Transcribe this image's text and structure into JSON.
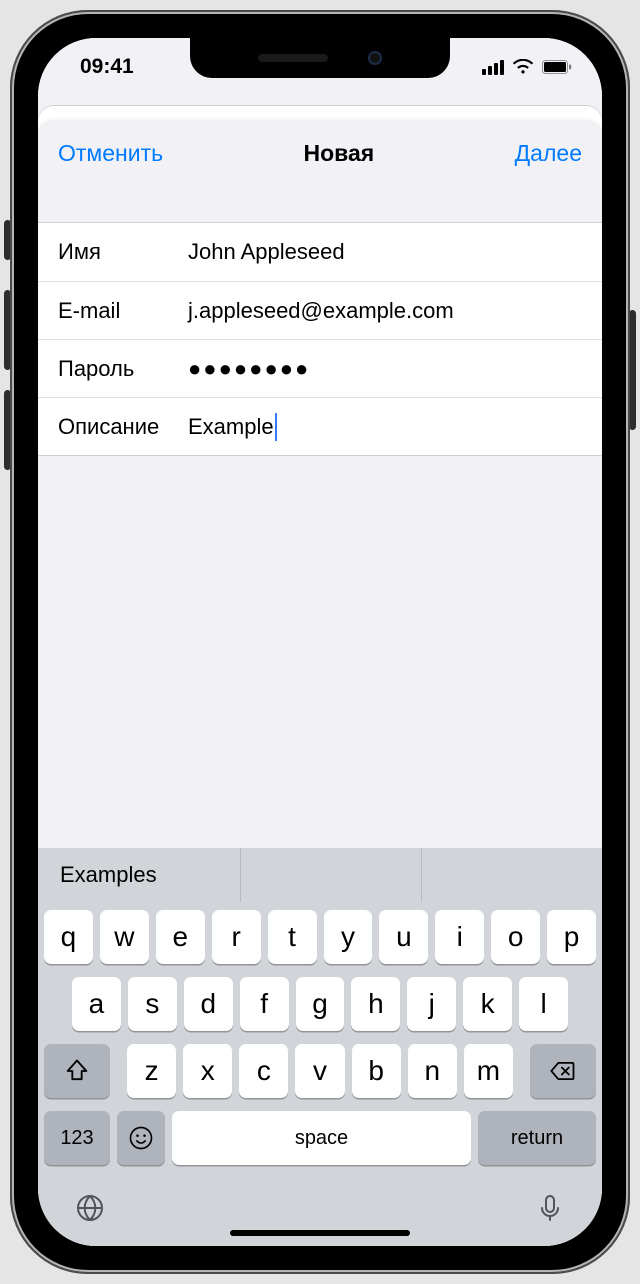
{
  "status": {
    "time": "09:41"
  },
  "nav": {
    "cancel": "Отменить",
    "title": "Новая",
    "next": "Далее"
  },
  "form": {
    "name_label": "Имя",
    "name_value": "John Appleseed",
    "email_label": "E-mail",
    "email_value": "j.appleseed@example.com",
    "password_label": "Пароль",
    "password_value": "●●●●●●●●",
    "desc_label": "Описание",
    "desc_value": "Example"
  },
  "suggestion": "Examples",
  "keyboard": {
    "row1": [
      "q",
      "w",
      "e",
      "r",
      "t",
      "y",
      "u",
      "i",
      "o",
      "p"
    ],
    "row2": [
      "a",
      "s",
      "d",
      "f",
      "g",
      "h",
      "j",
      "k",
      "l"
    ],
    "row3": [
      "z",
      "x",
      "c",
      "v",
      "b",
      "n",
      "m"
    ],
    "num": "123",
    "space": "space",
    "return": "return"
  }
}
